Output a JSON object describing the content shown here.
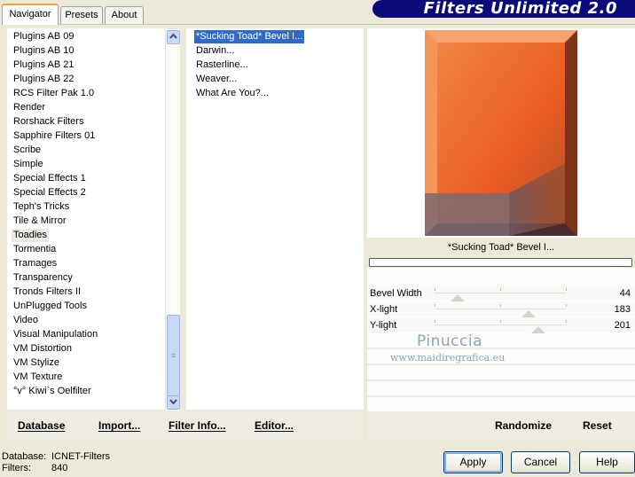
{
  "tabs": [
    {
      "label": "Navigator"
    },
    {
      "label": "Presets"
    },
    {
      "label": "About"
    }
  ],
  "brand_title": "Filters Unlimited 2.0",
  "categories": [
    "Plugins AB 09",
    "Plugins AB 10",
    "Plugins AB 21",
    "Plugins AB 22",
    "RCS Filter Pak 1.0",
    "Render",
    "Rorshack Filters",
    "Sapphire Filters 01",
    "Scribe",
    "Simple",
    "Special Effects 1",
    "Special Effects 2",
    "Teph's Tricks",
    "Tile & Mirror",
    "Toadies",
    "Tormentia",
    "Tramages",
    "Transparency",
    "Tronds Filters II",
    "UnPlugged Tools",
    "Video",
    "Visual Manipulation",
    "VM Distortion",
    "VM Stylize",
    "VM Texture",
    "°v° Kiwi`s Oelfilter"
  ],
  "selected_category": "Toadies",
  "filters": [
    "*Sucking Toad*  Bevel I...",
    "Darwin...",
    "Rasterline...",
    "Weaver...",
    "What Are You?..."
  ],
  "selected_filter": "*Sucking Toad*  Bevel I...",
  "preview_caption": "*Sucking Toad*  Bevel I...",
  "sliders": [
    {
      "label": "Bevel Width",
      "value": "44",
      "level": 44
    },
    {
      "label": "X-light",
      "value": "183",
      "level": 183
    },
    {
      "label": "Y-light",
      "value": "201",
      "level": 201
    }
  ],
  "watermark": {
    "name": "Pinuccia",
    "url": "www.maidiregrafica.eu"
  },
  "bottom_actions": {
    "database": "Database",
    "import": "Import...",
    "filter_info": "Filter Info...",
    "editor": "Editor...",
    "randomize": "Randomize",
    "reset": "Reset"
  },
  "status": {
    "database_label": "Database:",
    "database_value": "ICNET-Filters",
    "filters_label": "Filters:",
    "filters_value": "840"
  },
  "buttons": {
    "apply": "Apply",
    "cancel": "Cancel",
    "help": "Help"
  },
  "scrollbar_icons": {
    "up": "arrow-up-icon",
    "down": "arrow-down-icon"
  },
  "colors": {
    "banner": "#0a0a78",
    "selection": "#316ac5",
    "preview_orange": "#f06a2a",
    "preview_bevel_dark": "#7a3418"
  }
}
